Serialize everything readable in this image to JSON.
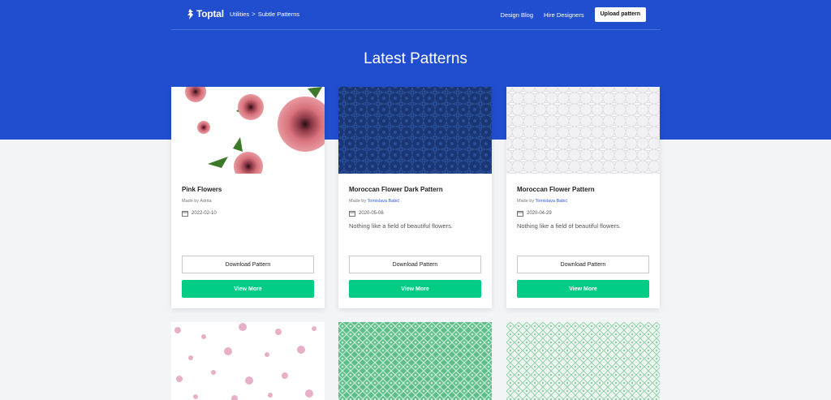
{
  "brand": {
    "logo_text": "Toptal"
  },
  "breadcrumb": {
    "item1": "Utilities",
    "separator": ">",
    "item2": "Subtle Patterns"
  },
  "nav": {
    "design_blog": "Design Blog",
    "hire_designers": "Hire Designers",
    "upload": "Upload pattern"
  },
  "page": {
    "title": "Latest Patterns"
  },
  "colors": {
    "hero": "#204ecf",
    "accent_green": "#00cc83",
    "link_blue": "#2d5be3"
  },
  "cards": [
    {
      "name": "Pink Flowers",
      "made_by_prefix": "Made by ",
      "author": "Adrita",
      "date": "2022-02-10",
      "description": "",
      "download_label": "Download Pattern",
      "view_label": "View More"
    },
    {
      "name": "Moroccan Flower Dark Pattern",
      "made_by_prefix": "Made by ",
      "author": "Tomislava Babić",
      "date": "2020-05-06",
      "description": "Nothing like a field of beautiful flowers.",
      "download_label": "Download Pattern",
      "view_label": "View More"
    },
    {
      "name": "Moroccan Flower Pattern",
      "made_by_prefix": "Made by ",
      "author": "Tomislava Babić",
      "date": "2020-04-29",
      "description": "Nothing like a field of beautiful flowers.",
      "download_label": "Download Pattern",
      "view_label": "View More"
    }
  ]
}
